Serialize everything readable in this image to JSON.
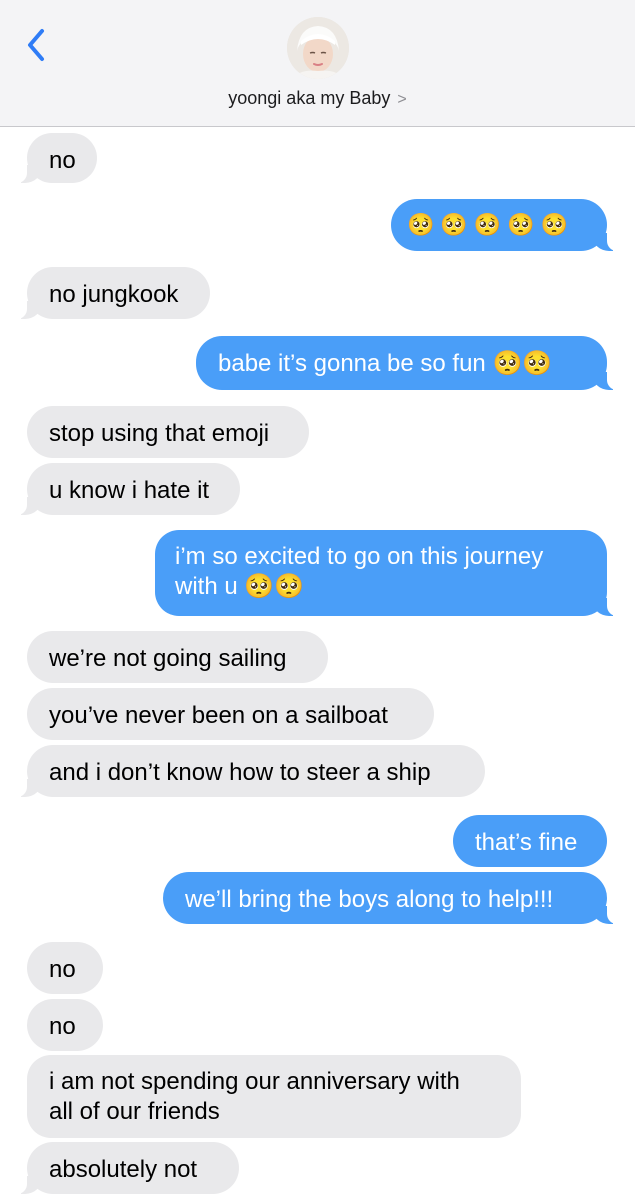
{
  "header": {
    "contact_name": "yoongi aka my Baby",
    "chevron": ">",
    "back_icon": "chevron-left-icon"
  },
  "messages": [
    {
      "from": "them",
      "text": "no"
    },
    {
      "from": "me",
      "text": "🥺🥺🥺🥺🥺"
    },
    {
      "from": "them",
      "text": "no jungkook"
    },
    {
      "from": "me",
      "text": "babe it’s gonna be so fun 🥺🥺"
    },
    {
      "from": "them",
      "text": "stop using that emoji"
    },
    {
      "from": "them",
      "text": "u know i hate it"
    },
    {
      "from": "me",
      "text": "i’m so excited to go on this journey",
      "text2": "with u 🥺🥺"
    },
    {
      "from": "them",
      "text": "we’re not going sailing"
    },
    {
      "from": "them",
      "text": "you’ve never been on a sailboat"
    },
    {
      "from": "them",
      "text": "and i don’t know how to steer a ship"
    },
    {
      "from": "me",
      "text": "that’s fine"
    },
    {
      "from": "me",
      "text": "we’ll bring the boys along to help!!!"
    },
    {
      "from": "them",
      "text": "no"
    },
    {
      "from": "them",
      "text": "no"
    },
    {
      "from": "them",
      "text": "i am not spending our anniversary with",
      "text2": "all of our friends"
    },
    {
      "from": "them",
      "text": "absolutely not"
    }
  ],
  "colors": {
    "incoming_bubble": "#e9e9eb",
    "outgoing_bubble": "#4a9ef8",
    "accent": "#2f7cf6"
  }
}
